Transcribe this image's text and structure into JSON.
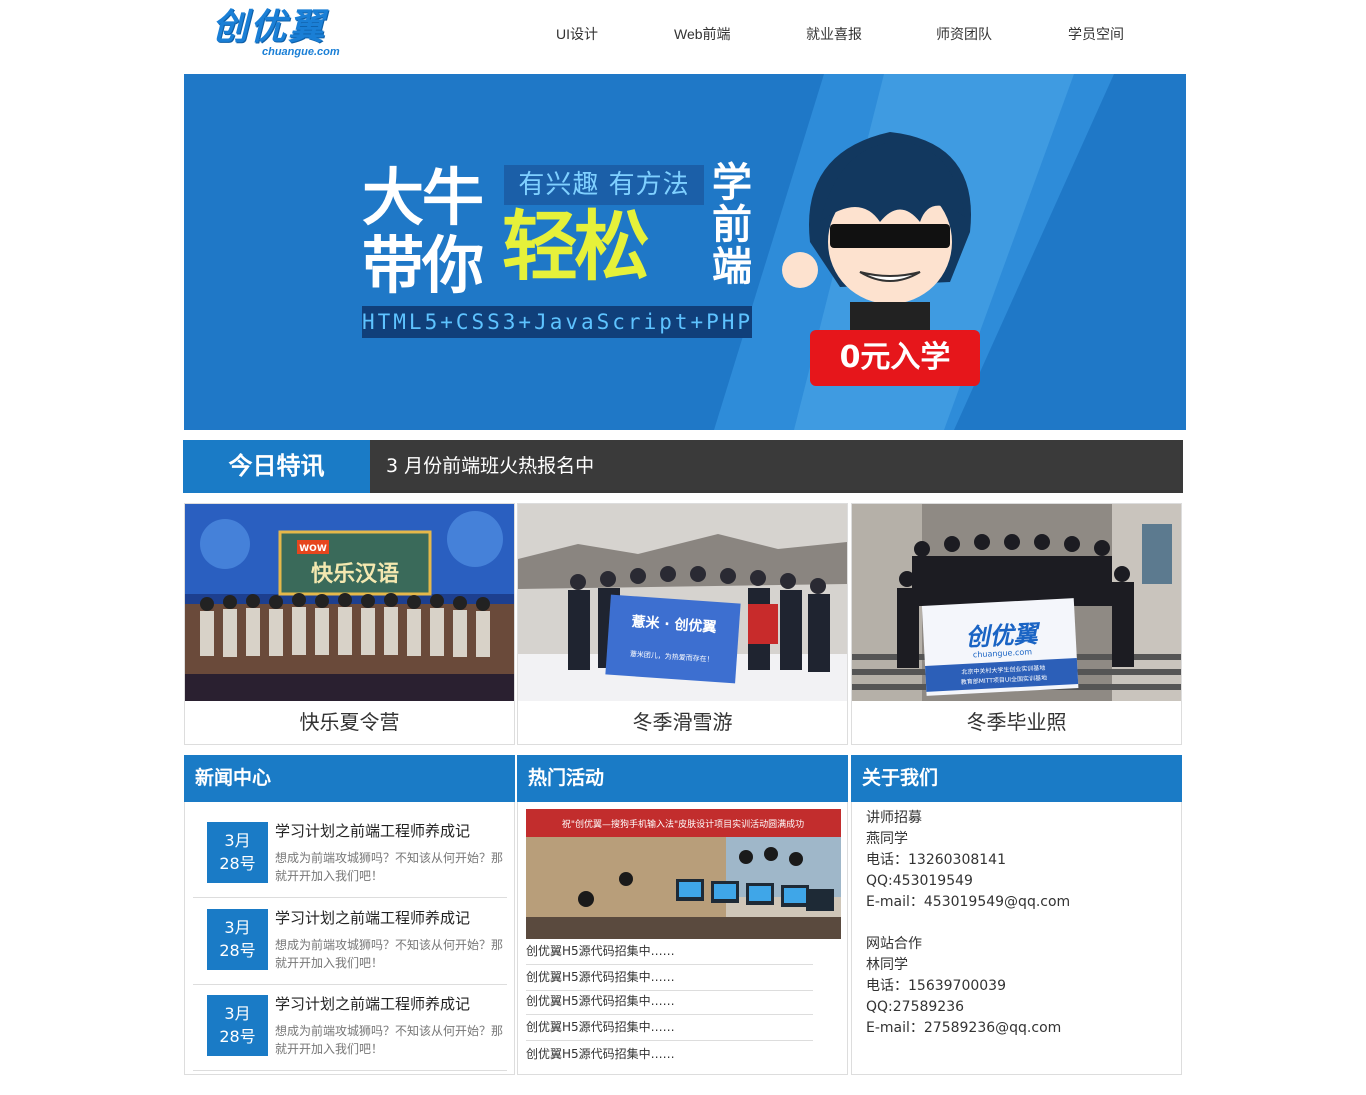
{
  "brand": {
    "logo_main": "创优翼",
    "logo_sub": "chuangue.com"
  },
  "nav": [
    "UI设计",
    "Web前端",
    "就业喜报",
    "师资团队",
    "学员空间"
  ],
  "banner": {
    "line1": "大牛",
    "line2": "带你",
    "slogan": "有兴趣 有方法",
    "easy": "轻松",
    "vertical": "学前端",
    "tech": "HTML5+CSS3+JavaScript+PHP",
    "cta": "0元入学"
  },
  "ticker": {
    "label": "今日特讯",
    "text": "3 月份前端班火热报名中"
  },
  "photos": [
    {
      "caption": "快乐夏令营",
      "sign_top": "WOW",
      "sign_text": "快乐汉语"
    },
    {
      "caption": "冬季滑雪游",
      "flag_text": "薏米 · 创优翼",
      "flag_sub": "薏米团儿，为热爱而存在！"
    },
    {
      "caption": "冬季毕业照",
      "flag_text": "创优翼",
      "flag_url": "chuangue.com",
      "flag_sub1": "北京中关村大学生创业实训基地",
      "flag_sub2": "教育部MITT项目UI全国实训基地"
    }
  ],
  "panels": {
    "news": {
      "title": "新闻中心",
      "items": [
        {
          "month": "3月",
          "day": "28号",
          "title": "学习计划之前端工程师养成记",
          "desc": "想成为前端攻城狮吗？不知该从何开始？那就开开加入我们吧！"
        },
        {
          "month": "3月",
          "day": "28号",
          "title": "学习计划之前端工程师养成记",
          "desc": "想成为前端攻城狮吗？不知该从何开始？那就开开加入我们吧！"
        },
        {
          "month": "3月",
          "day": "28号",
          "title": "学习计划之前端工程师养成记",
          "desc": "想成为前端攻城狮吗？不知该从何开始？那就开开加入我们吧！"
        }
      ]
    },
    "activities": {
      "title": "热门活动",
      "banner_text": "祝\"创优翼—搜狗手机输入法\"皮肤设计项目实训活动圆满成功",
      "links": [
        "创优翼H5源代码招集中……",
        "创优翼H5源代码招集中……",
        "创优翼H5源代码招集中……",
        "创优翼H5源代码招集中……",
        "创优翼H5源代码招集中……"
      ]
    },
    "about": {
      "title": "关于我们",
      "recruit_label": "讲师招募",
      "recruit_name": "燕同学",
      "recruit_phone": "电话：13260308141",
      "recruit_qq": "QQ:453019549",
      "recruit_email": "E-mail：453019549@qq.com",
      "coop_label": "网站合作",
      "coop_name": "林同学",
      "coop_phone": "电话：15639700039",
      "coop_qq": "QQ:27589236",
      "coop_email": "E-mail：27589236@qq.com"
    }
  }
}
